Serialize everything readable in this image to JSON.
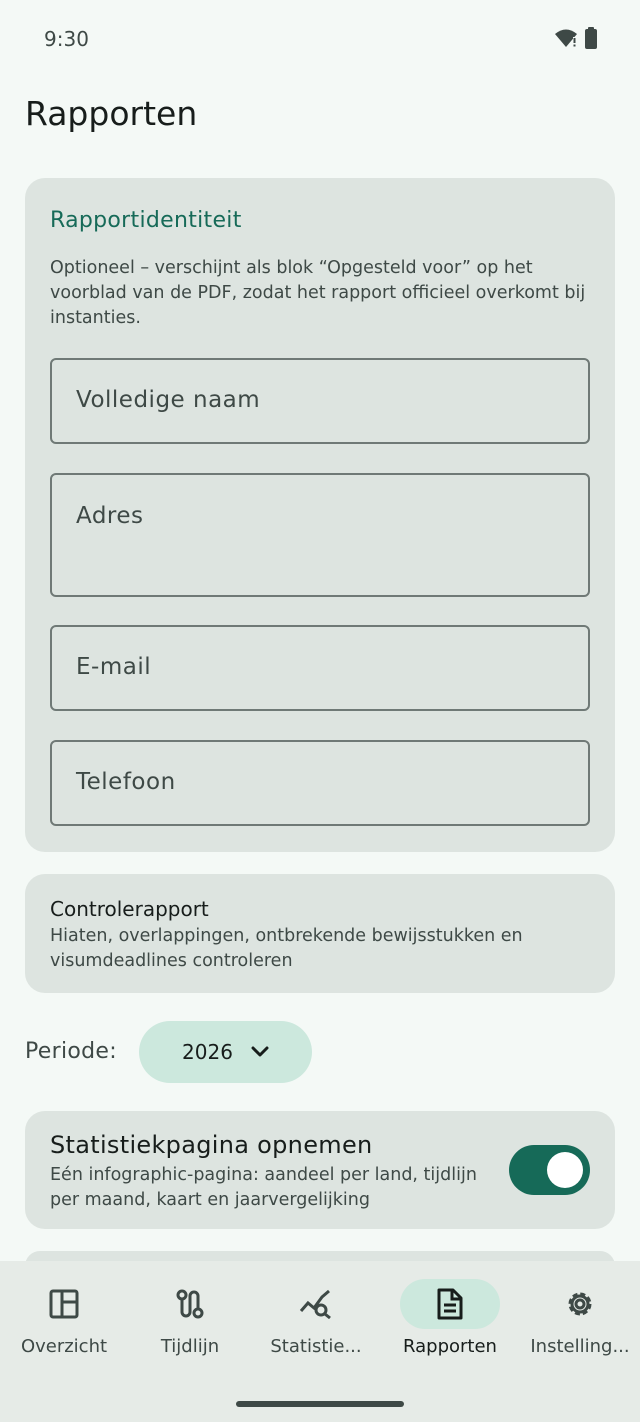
{
  "status_bar": {
    "time": "9:30",
    "icons": [
      "wifi-icon",
      "battery-icon"
    ]
  },
  "page": {
    "title": "Rapporten"
  },
  "identity": {
    "title": "Rapportidentiteit",
    "description": "Optioneel – verschijnt als blok “Opgesteld voor” op het voorblad van de PDF, zodat het rapport officieel overkomt bij instanties.",
    "fields": {
      "name_placeholder": "Volledige naam",
      "address_placeholder": "Adres",
      "email_placeholder": "E-mail",
      "phone_placeholder": "Telefoon"
    }
  },
  "check_report": {
    "title": "Controlerapport",
    "description": "Hiaten, overlappingen, ontbrekende bewijsstukken en visumdeadlines controleren"
  },
  "period": {
    "label": "Periode:",
    "selected": "2026"
  },
  "stats_page": {
    "title": "Statistiekpagina opnemen",
    "description": "Eén infographic-pagina: aandeel per land, tijdlijn per maand, kaart en jaarvergelijking",
    "enabled": true
  },
  "nav": {
    "items": [
      {
        "label": "Overzicht",
        "icon": "dashboard-icon"
      },
      {
        "label": "Tijdlijn",
        "icon": "route-icon"
      },
      {
        "label": "Statistie...",
        "icon": "analytics-icon"
      },
      {
        "label": "Rapporten",
        "icon": "document-icon",
        "active": true
      },
      {
        "label": "Instelling...",
        "icon": "settings-icon"
      }
    ]
  },
  "colors": {
    "accent": "#166a58",
    "surface": "#dde4e0",
    "background": "#f4f9f6",
    "chip": "#cce8dd"
  }
}
